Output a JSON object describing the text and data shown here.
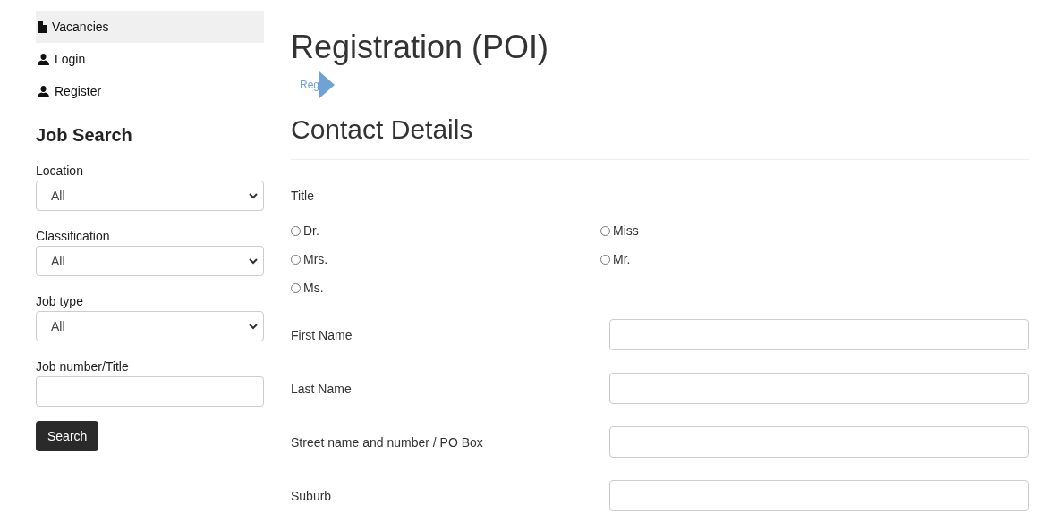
{
  "nav": [
    {
      "label": "Vacancies",
      "kind": "document",
      "selected": true
    },
    {
      "label": "Login",
      "kind": "person",
      "selected": false
    },
    {
      "label": "Register",
      "kind": "person",
      "selected": false
    }
  ],
  "job_search": {
    "title": "Job Search",
    "filters": [
      {
        "label": "Location",
        "kind": "select",
        "value": "All"
      },
      {
        "label": "Classification",
        "kind": "select",
        "value": "All"
      },
      {
        "label": "Job type",
        "kind": "select",
        "value": "All"
      },
      {
        "label": "Job number/Title",
        "kind": "text"
      }
    ],
    "button": "Search"
  },
  "page_title": "Registration (POI)",
  "breadcrumb": [
    "Reg"
  ],
  "section_title": "Contact Details",
  "title_field": {
    "label": "Title",
    "options": [
      {
        "label": "Dr.",
        "checked": false
      },
      {
        "label": "Miss",
        "checked": false
      },
      {
        "label": "Mrs.",
        "checked": false
      },
      {
        "label": "Mr.",
        "checked": false
      },
      {
        "label": "Ms.",
        "checked": false
      }
    ]
  },
  "fields": [
    {
      "label": "First Name"
    },
    {
      "label": "Last Name"
    },
    {
      "label": "Street name and number / PO Box"
    },
    {
      "label": "Suburb"
    }
  ]
}
